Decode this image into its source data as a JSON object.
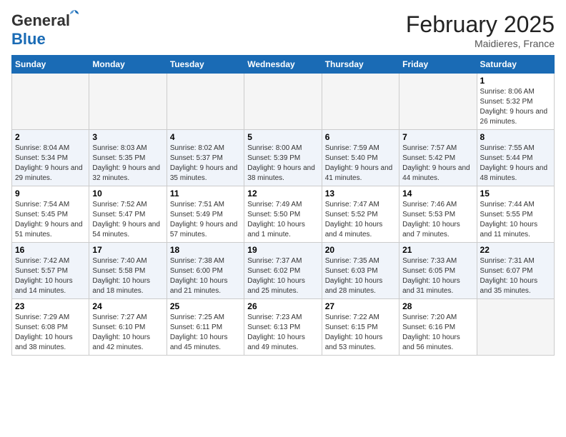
{
  "header": {
    "logo_general": "General",
    "logo_blue": "Blue",
    "month_year": "February 2025",
    "location": "Maidieres, France"
  },
  "days_of_week": [
    "Sunday",
    "Monday",
    "Tuesday",
    "Wednesday",
    "Thursday",
    "Friday",
    "Saturday"
  ],
  "weeks": [
    {
      "alt": false,
      "days": [
        {
          "num": "",
          "info": ""
        },
        {
          "num": "",
          "info": ""
        },
        {
          "num": "",
          "info": ""
        },
        {
          "num": "",
          "info": ""
        },
        {
          "num": "",
          "info": ""
        },
        {
          "num": "",
          "info": ""
        },
        {
          "num": "1",
          "info": "Sunrise: 8:06 AM\nSunset: 5:32 PM\nDaylight: 9 hours and 26 minutes."
        }
      ]
    },
    {
      "alt": true,
      "days": [
        {
          "num": "2",
          "info": "Sunrise: 8:04 AM\nSunset: 5:34 PM\nDaylight: 9 hours and 29 minutes."
        },
        {
          "num": "3",
          "info": "Sunrise: 8:03 AM\nSunset: 5:35 PM\nDaylight: 9 hours and 32 minutes."
        },
        {
          "num": "4",
          "info": "Sunrise: 8:02 AM\nSunset: 5:37 PM\nDaylight: 9 hours and 35 minutes."
        },
        {
          "num": "5",
          "info": "Sunrise: 8:00 AM\nSunset: 5:39 PM\nDaylight: 9 hours and 38 minutes."
        },
        {
          "num": "6",
          "info": "Sunrise: 7:59 AM\nSunset: 5:40 PM\nDaylight: 9 hours and 41 minutes."
        },
        {
          "num": "7",
          "info": "Sunrise: 7:57 AM\nSunset: 5:42 PM\nDaylight: 9 hours and 44 minutes."
        },
        {
          "num": "8",
          "info": "Sunrise: 7:55 AM\nSunset: 5:44 PM\nDaylight: 9 hours and 48 minutes."
        }
      ]
    },
    {
      "alt": false,
      "days": [
        {
          "num": "9",
          "info": "Sunrise: 7:54 AM\nSunset: 5:45 PM\nDaylight: 9 hours and 51 minutes."
        },
        {
          "num": "10",
          "info": "Sunrise: 7:52 AM\nSunset: 5:47 PM\nDaylight: 9 hours and 54 minutes."
        },
        {
          "num": "11",
          "info": "Sunrise: 7:51 AM\nSunset: 5:49 PM\nDaylight: 9 hours and 57 minutes."
        },
        {
          "num": "12",
          "info": "Sunrise: 7:49 AM\nSunset: 5:50 PM\nDaylight: 10 hours and 1 minute."
        },
        {
          "num": "13",
          "info": "Sunrise: 7:47 AM\nSunset: 5:52 PM\nDaylight: 10 hours and 4 minutes."
        },
        {
          "num": "14",
          "info": "Sunrise: 7:46 AM\nSunset: 5:53 PM\nDaylight: 10 hours and 7 minutes."
        },
        {
          "num": "15",
          "info": "Sunrise: 7:44 AM\nSunset: 5:55 PM\nDaylight: 10 hours and 11 minutes."
        }
      ]
    },
    {
      "alt": true,
      "days": [
        {
          "num": "16",
          "info": "Sunrise: 7:42 AM\nSunset: 5:57 PM\nDaylight: 10 hours and 14 minutes."
        },
        {
          "num": "17",
          "info": "Sunrise: 7:40 AM\nSunset: 5:58 PM\nDaylight: 10 hours and 18 minutes."
        },
        {
          "num": "18",
          "info": "Sunrise: 7:38 AM\nSunset: 6:00 PM\nDaylight: 10 hours and 21 minutes."
        },
        {
          "num": "19",
          "info": "Sunrise: 7:37 AM\nSunset: 6:02 PM\nDaylight: 10 hours and 25 minutes."
        },
        {
          "num": "20",
          "info": "Sunrise: 7:35 AM\nSunset: 6:03 PM\nDaylight: 10 hours and 28 minutes."
        },
        {
          "num": "21",
          "info": "Sunrise: 7:33 AM\nSunset: 6:05 PM\nDaylight: 10 hours and 31 minutes."
        },
        {
          "num": "22",
          "info": "Sunrise: 7:31 AM\nSunset: 6:07 PM\nDaylight: 10 hours and 35 minutes."
        }
      ]
    },
    {
      "alt": false,
      "days": [
        {
          "num": "23",
          "info": "Sunrise: 7:29 AM\nSunset: 6:08 PM\nDaylight: 10 hours and 38 minutes."
        },
        {
          "num": "24",
          "info": "Sunrise: 7:27 AM\nSunset: 6:10 PM\nDaylight: 10 hours and 42 minutes."
        },
        {
          "num": "25",
          "info": "Sunrise: 7:25 AM\nSunset: 6:11 PM\nDaylight: 10 hours and 45 minutes."
        },
        {
          "num": "26",
          "info": "Sunrise: 7:23 AM\nSunset: 6:13 PM\nDaylight: 10 hours and 49 minutes."
        },
        {
          "num": "27",
          "info": "Sunrise: 7:22 AM\nSunset: 6:15 PM\nDaylight: 10 hours and 53 minutes."
        },
        {
          "num": "28",
          "info": "Sunrise: 7:20 AM\nSunset: 6:16 PM\nDaylight: 10 hours and 56 minutes."
        },
        {
          "num": "",
          "info": ""
        }
      ]
    }
  ]
}
